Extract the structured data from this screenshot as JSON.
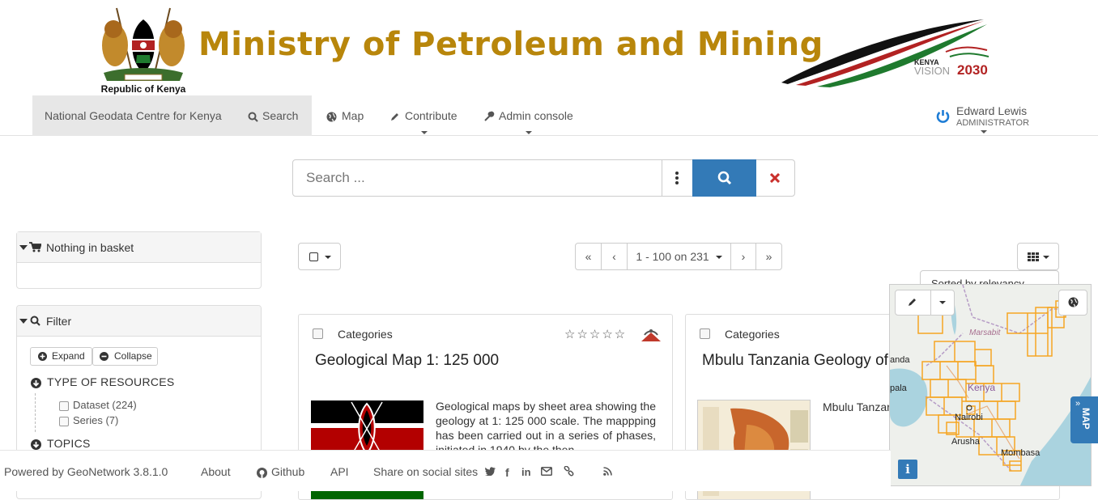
{
  "header": {
    "crest_caption": "Republic of Kenya",
    "ministry_title": "Ministry of Petroleum and Mining",
    "vision_kenya": "KENYA",
    "vision_text": "VISION",
    "vision_year": "2030"
  },
  "navbar": {
    "home": "National Geodata Centre for Kenya",
    "search": "Search",
    "map": "Map",
    "contribute": "Contribute",
    "admin": "Admin console",
    "user_name": "Edward Lewis",
    "user_role": "ADMINISTRATOR"
  },
  "search": {
    "placeholder": "Search ..."
  },
  "basket": {
    "title": "Nothing in basket"
  },
  "filter": {
    "title": "Filter",
    "expand": "Expand",
    "collapse": "Collapse",
    "type_heading": "TYPE OF RESOURCES",
    "items": [
      {
        "label": "Dataset (224)"
      },
      {
        "label": "Series (7)"
      }
    ],
    "topics_heading": "TOPICS"
  },
  "pager": {
    "range": "1 - 100 on 231"
  },
  "sort": {
    "label": "Sorted by relevancy"
  },
  "results": [
    {
      "category": "Categories",
      "title": "Geological Map 1: 125 000",
      "description": "Geological maps by sheet area showing the geology at 1: 125 000 scale. The mappping has been carried out in a series of phases, initiated in 1940 by the then",
      "rating": 0
    },
    {
      "category": "Categories",
      "title": "Mbulu Tanzania Geology of",
      "description": "Mbulu Tanzar"
    }
  ],
  "map": {
    "labels": [
      "Marsabit",
      "Kenya",
      "Nairobi",
      "Arusha",
      "Mombasa",
      "anda",
      "pala"
    ],
    "tab_label": "MAP"
  },
  "footer": {
    "powered": "Powered by GeoNetwork 3.8.1.0",
    "about": "About",
    "github": "Github",
    "api": "API",
    "share": "Share on social sites"
  },
  "colors": {
    "ministry_gold": "#b8860b",
    "primary_blue": "#337ab7",
    "clear_red": "#c9302c",
    "map_grid_orange": "#f5a623",
    "user_icon_blue": "#1c7cd5"
  }
}
